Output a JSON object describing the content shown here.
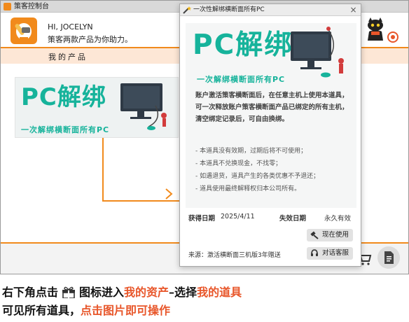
{
  "main_window": {
    "title": "策客控制台",
    "greeting": "HI, JOCELYN",
    "subtitle": "策客两款产品为你助力。",
    "tab": "我的产品",
    "card": {
      "title": "PC解绑",
      "subtitle": "一次解绑横断面所有PC"
    }
  },
  "dialog": {
    "title": "一次性解绑横断面所有PC",
    "close": "×",
    "banner_title": "PC解绑",
    "banner_subtitle": "一次解绑横断面所有PC",
    "description": "账户激活策客横断面后，在任意主机上使用本道具，可一次释放账户策客横断面产品已绑定的所有主机，清空绑定记录后，可自由换绑。",
    "rules": [
      "本道具没有效期，过期后将不可使用；",
      "本道具不兑换现金，不找零；",
      "如遇退货，道具产生的各类优惠不予退还；",
      "道具使用最终解释权归本公司所有。"
    ],
    "obtain_label": "获得日期",
    "obtain_date": "2025/4/11",
    "expire_label": "失效日期",
    "expire_value": "永久有效",
    "use_button": "现在使用",
    "service_button": "对话客服",
    "source": "来源：激活横断面三机版3年赠送"
  },
  "caption": {
    "line1_a": "右下角点击",
    "line1_b": "图标进入",
    "line1_c": "我的资产",
    "line1_d": "–选择",
    "line1_e": "我的道具",
    "line2_a": "可见所有道具，",
    "line2_b": "点击图片即可操作"
  },
  "colors": {
    "accent": "#f18a1c",
    "teal": "#16b39b",
    "highlight": "#e8562a"
  }
}
